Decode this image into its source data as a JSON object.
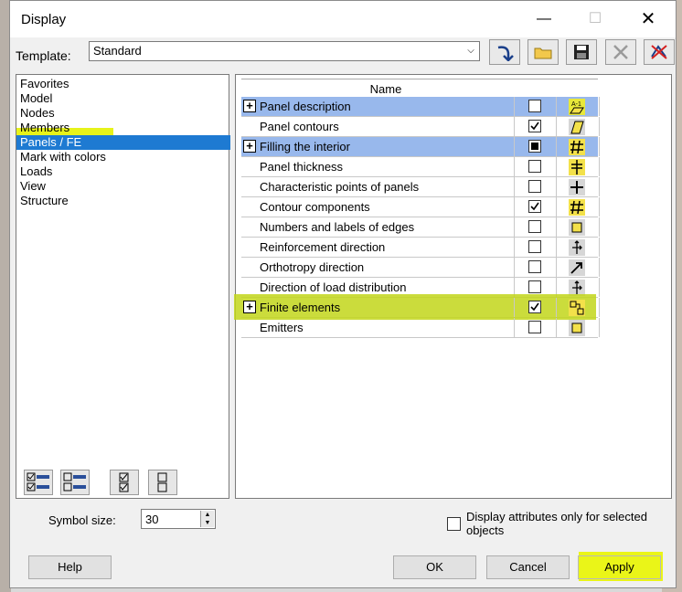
{
  "window": {
    "title": "Display",
    "close_glyph": "✕",
    "minimize_glyph": "—",
    "maximize_glyph": "☐"
  },
  "template": {
    "label": "Template:",
    "value": "Standard",
    "toolbar_icons": [
      "apply-arrow-icon",
      "open-folder-icon",
      "save-icon",
      "delete-icon",
      "cancel-delete-icon"
    ]
  },
  "tree": {
    "items": [
      {
        "label": "Favorites",
        "selected": false
      },
      {
        "label": "Model",
        "selected": false
      },
      {
        "label": "Nodes",
        "selected": false
      },
      {
        "label": "Members",
        "selected": false
      },
      {
        "label": "Panels / FE",
        "selected": true
      },
      {
        "label": "Mark with colors",
        "selected": false
      },
      {
        "label": "Loads",
        "selected": false
      },
      {
        "label": "View",
        "selected": false
      },
      {
        "label": "Structure",
        "selected": false
      }
    ]
  },
  "grid": {
    "header": "Name",
    "rows": [
      {
        "label": "Panel description",
        "expander": "+",
        "checked": "empty",
        "highlight": "blue",
        "icon": "label-icon"
      },
      {
        "label": "Panel contours",
        "expander": "",
        "checked": "check",
        "highlight": "",
        "icon": "contour-icon"
      },
      {
        "label": "Filling the interior",
        "expander": "+",
        "checked": "filled",
        "highlight": "blue",
        "icon": "hash-icon"
      },
      {
        "label": "Panel thickness",
        "expander": "",
        "checked": "empty",
        "highlight": "",
        "icon": "thickness-icon"
      },
      {
        "label": "Characteristic points of panels",
        "expander": "",
        "checked": "empty",
        "highlight": "",
        "icon": "cross-icon"
      },
      {
        "label": "Contour components",
        "expander": "",
        "checked": "check",
        "highlight": "",
        "icon": "hash-icon"
      },
      {
        "label": "Numbers and labels of edges",
        "expander": "",
        "checked": "empty",
        "highlight": "",
        "icon": "square-icon"
      },
      {
        "label": "Reinforcement direction",
        "expander": "",
        "checked": "empty",
        "highlight": "",
        "icon": "arrows-icon"
      },
      {
        "label": "Orthotropy direction",
        "expander": "",
        "checked": "empty",
        "highlight": "",
        "icon": "diagonal-arrow-icon"
      },
      {
        "label": "Direction of load distribution",
        "expander": "",
        "checked": "empty",
        "highlight": "",
        "icon": "arrows-icon"
      },
      {
        "label": "Finite elements",
        "expander": "+",
        "checked": "check",
        "highlight": "yellow",
        "icon": "fe-icon"
      },
      {
        "label": "Emitters",
        "expander": "",
        "checked": "empty",
        "highlight": "",
        "icon": "square-icon"
      }
    ]
  },
  "bottom": {
    "symbol_size_label": "Symbol size:",
    "symbol_size_value": "30",
    "attr_label": "Display attributes only for selected objects",
    "help": "Help",
    "ok": "OK",
    "cancel": "Cancel",
    "apply": "Apply"
  },
  "colors": {
    "selection": "#1e7ad2",
    "row_highlight": "#98b8ec",
    "marker": "#e7f31a"
  }
}
